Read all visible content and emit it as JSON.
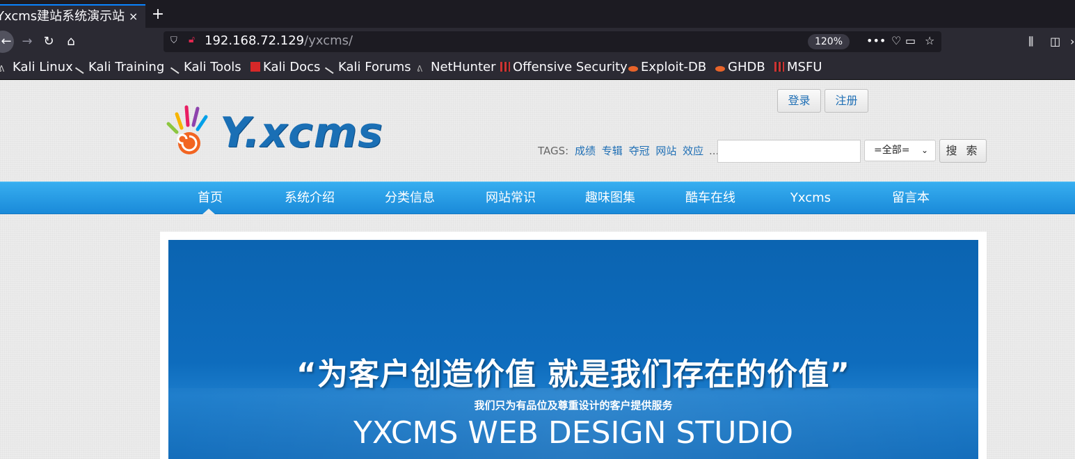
{
  "browser": {
    "tab_title": "Yxcms建站系统演示站",
    "tab_close": "×",
    "new_tab": "+",
    "url_host": "192.168.72.129",
    "url_path": "/yxcms/",
    "zoom": "120%",
    "bookmarks": [
      {
        "label": "Kali Linux",
        "icon": "kali-dragon-icon"
      },
      {
        "label": "Kali Training",
        "icon": "kali-dragon-icon"
      },
      {
        "label": "Kali Tools",
        "icon": "kali-dragon-icon"
      },
      {
        "label": "Kali Docs",
        "icon": "kali-docs-icon"
      },
      {
        "label": "Kali Forums",
        "icon": "kali-dragon-icon"
      },
      {
        "label": "NetHunter",
        "icon": "nethunter-icon"
      },
      {
        "label": "Offensive Security",
        "icon": "offsec-icon"
      },
      {
        "label": "Exploit-DB",
        "icon": "exploitdb-icon"
      },
      {
        "label": "GHDB",
        "icon": "exploitdb-icon"
      },
      {
        "label": "MSFU",
        "icon": "offsec-icon"
      }
    ]
  },
  "header": {
    "logo_text": "Y.xcms",
    "login_label": "登录",
    "register_label": "注册",
    "tags_label": "TAGS:",
    "tags": [
      "成绩",
      "专辑",
      "夺冠",
      "网站",
      "效应"
    ],
    "tags_more": "...",
    "search_value": "",
    "search_select": "=全部=",
    "search_button": "搜 索"
  },
  "menu": {
    "items": [
      "首页",
      "系统介绍",
      "分类信息",
      "网站常识",
      "趣味图集",
      "酷车在线",
      "Yxcms",
      "留言本"
    ],
    "active_index": 0
  },
  "banner": {
    "slogan": "“为客户创造价值  就是我们存在的价值”",
    "subtitle": "我们只为有品位及尊重设计的客户提供服务",
    "studio": "YXCMS WEB DESIGN STUDIO"
  },
  "colors": {
    "accent": "#1f6fb5",
    "menu_top": "#37aef0",
    "menu_bottom": "#1a8ad9",
    "banner": "#0e6cbd"
  }
}
